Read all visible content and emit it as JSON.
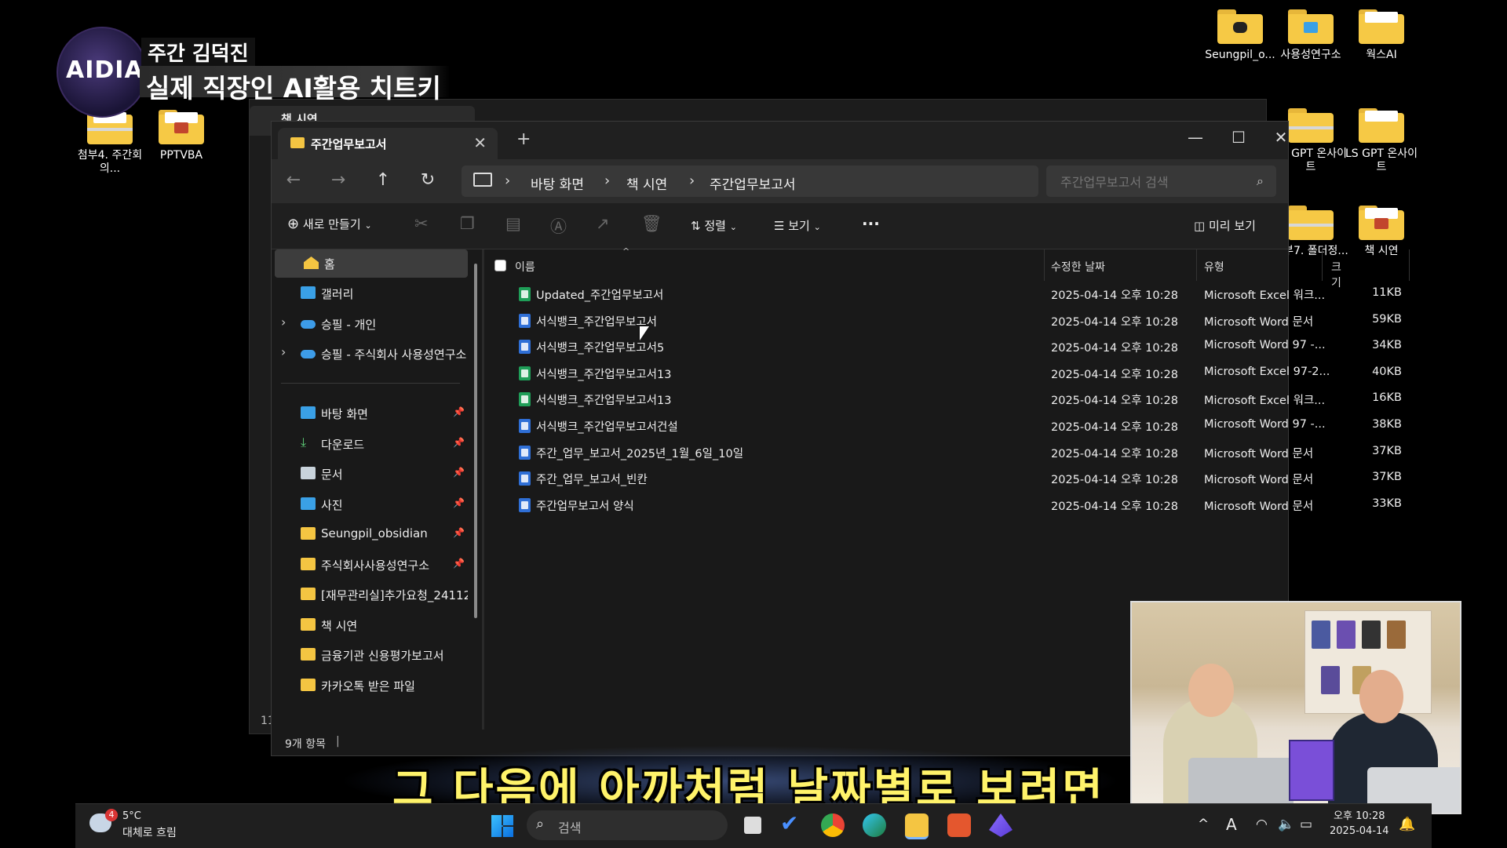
{
  "overlay": {
    "logo": "AIDIA",
    "channel_name": "주간 김덕진",
    "episode_tag": "실제 직장인 AI활용 치트키",
    "subtitle": "그 다음에 아까처럼 날짜별로 보려면"
  },
  "desktop_icons": [
    {
      "label": "첨부4. 주간회의...",
      "kind": "zip"
    },
    {
      "label": "PPTVBA",
      "kind": "folder"
    },
    {
      "label": "Seungpil_o...",
      "kind": "folder"
    },
    {
      "label": "사용성연구소",
      "kind": "folder"
    },
    {
      "label": "웍스AI",
      "kind": "folder"
    },
    {
      "label": "LS GPT 온사이트",
      "kind": "zip"
    },
    {
      "label": "LS GPT 온사이트",
      "kind": "folder"
    },
    {
      "label": "첨부7. 폴더정...",
      "kind": "zip"
    },
    {
      "label": "책 시연",
      "kind": "folder"
    }
  ],
  "back_window": {
    "tab_title": "책 시연",
    "status_fragment": "11"
  },
  "window": {
    "tab_title": "주간업무보고서",
    "new_tab": "+",
    "controls": {
      "minimize": "—",
      "maximize": "☐",
      "close": "✕"
    },
    "breadcrumb": [
      "바탕 화면",
      "책 시연",
      "주간업무보고서"
    ],
    "search_placeholder": "주간업무보고서 검색",
    "toolbar": {
      "new": "새로 만들기",
      "sort": "정렬",
      "view": "보기",
      "more": "···",
      "preview": "미리 보기"
    },
    "sidebar": {
      "top": [
        {
          "label": "홈",
          "icon": "home-icon"
        },
        {
          "label": "갤러리",
          "icon": "gallery-icon"
        },
        {
          "label": "승필 - 개인",
          "icon": "cloud-icon"
        },
        {
          "label": "승필 - 주식회사 사용성연구소",
          "icon": "cloud-icon"
        }
      ],
      "pinned": [
        {
          "label": "바탕 화면",
          "icon": "desktop-icon"
        },
        {
          "label": "다운로드",
          "icon": "download-icon"
        },
        {
          "label": "문서",
          "icon": "document-icon"
        },
        {
          "label": "사진",
          "icon": "picture-icon"
        },
        {
          "label": "Seungpil_obsidian",
          "icon": "folder-icon"
        },
        {
          "label": "주식회사사용성연구소",
          "icon": "folder-icon"
        },
        {
          "label": "[재무관리실]추가요청_241122",
          "icon": "folder-icon"
        },
        {
          "label": "책 시연",
          "icon": "folder-icon"
        },
        {
          "label": "금융기관 신용평가보고서",
          "icon": "folder-icon"
        },
        {
          "label": "카카오톡 받은 파일",
          "icon": "folder-icon"
        }
      ]
    },
    "columns": {
      "name": "이름",
      "modified": "수정한 날짜",
      "type": "유형",
      "size": "크기"
    },
    "files": [
      {
        "name": "Updated_주간업무보고서",
        "modified": "2025-04-14 오후 10:28",
        "type": "Microsoft Excel 워크...",
        "size": "11KB",
        "icon": "excel"
      },
      {
        "name": "서식뱅크_주간업무보고서",
        "modified": "2025-04-14 오후 10:28",
        "type": "Microsoft Word 문서",
        "size": "59KB",
        "icon": "word"
      },
      {
        "name": "서식뱅크_주간업무보고서5",
        "modified": "2025-04-14 오후 10:28",
        "type": "Microsoft Word 97 -...",
        "size": "34KB",
        "icon": "word"
      },
      {
        "name": "서식뱅크_주간업무보고서13",
        "modified": "2025-04-14 오후 10:28",
        "type": "Microsoft Excel 97-2...",
        "size": "40KB",
        "icon": "excel"
      },
      {
        "name": "서식뱅크_주간업무보고서13",
        "modified": "2025-04-14 오후 10:28",
        "type": "Microsoft Excel 워크...",
        "size": "16KB",
        "icon": "excel"
      },
      {
        "name": "서식뱅크_주간업무보고서건설",
        "modified": "2025-04-14 오후 10:28",
        "type": "Microsoft Word 97 -...",
        "size": "38KB",
        "icon": "word"
      },
      {
        "name": "주간_업무_보고서_2025년_1월_6일_10일",
        "modified": "2025-04-14 오후 10:28",
        "type": "Microsoft Word 문서",
        "size": "37KB",
        "icon": "word"
      },
      {
        "name": "주간_업무_보고서_빈칸",
        "modified": "2025-04-14 오후 10:28",
        "type": "Microsoft Word 문서",
        "size": "37KB",
        "icon": "word"
      },
      {
        "name": "주간업무보고서 양식",
        "modified": "2025-04-14 오후 10:28",
        "type": "Microsoft Word 문서",
        "size": "33KB",
        "icon": "word"
      }
    ],
    "status": "9개 항목"
  },
  "taskbar": {
    "weather_badge": "4",
    "weather_temp": "5°C",
    "weather_desc": "대체로 흐림",
    "search_placeholder": "검색",
    "tray": {
      "caret": "^",
      "ime": "A"
    },
    "clock_time": "오후 10:28",
    "clock_date": "2025-04-14"
  },
  "colors": {
    "accent_excel": "#1f9e58",
    "accent_word": "#2f6fd6",
    "subtitle": "#fff36a",
    "folder": "#f4c542"
  }
}
